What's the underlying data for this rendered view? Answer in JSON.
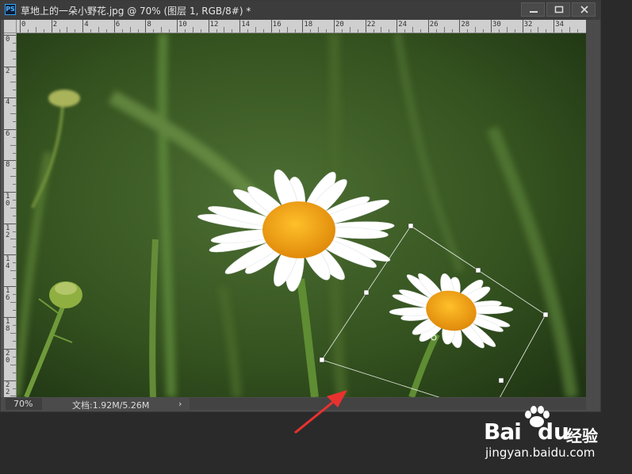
{
  "window": {
    "app_icon": "PS",
    "title": "草地上的一朵小野花.jpg @ 70% (图层 1, RGB/8#) *"
  },
  "rulers": {
    "top": [
      "0",
      "2",
      "4",
      "6",
      "8",
      "10",
      "12",
      "14",
      "16",
      "18",
      "20",
      "22",
      "24",
      "26",
      "28",
      "30",
      "32",
      "34"
    ],
    "left": [
      "0",
      "2",
      "4",
      "6",
      "8",
      "10",
      "12",
      "14",
      "16",
      "18",
      "20",
      "22"
    ]
  },
  "status": {
    "zoom": "70%",
    "doc_info": "文档:1.92M/5.26M",
    "arrow": "›"
  },
  "watermark": {
    "brand_left": "Bai",
    "brand_right": "du",
    "jingyan": "经验",
    "url": "jingyan.baidu.com"
  },
  "colors": {
    "annotation_arrow": "#e8322f",
    "petal": "#ffffff",
    "disc": "#f2a51a",
    "background_green": "#3a5a26"
  }
}
